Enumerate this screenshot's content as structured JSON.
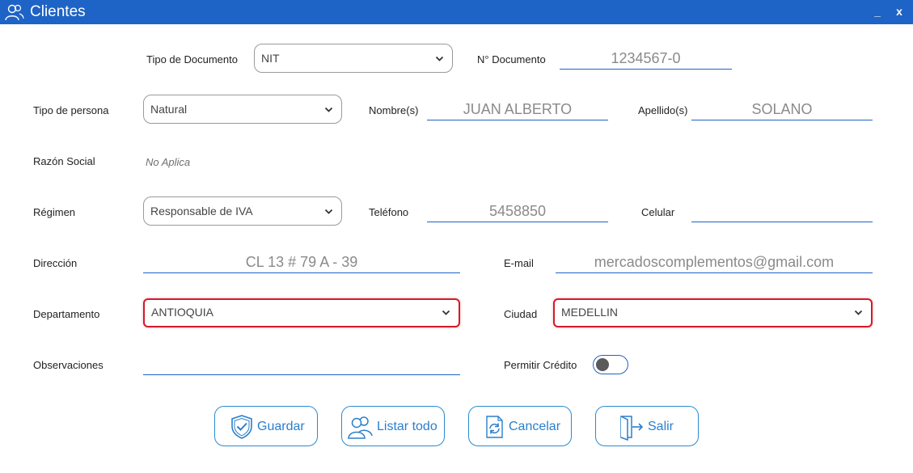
{
  "window": {
    "title": "Clientes",
    "minimize": "_",
    "close": "x",
    "accent": "#1e63c6"
  },
  "form": {
    "tipo_documento": {
      "label": "Tipo de Documento",
      "value": "NIT"
    },
    "numero_documento": {
      "label": "N° Documento",
      "value": "1234567-0"
    },
    "tipo_persona": {
      "label": "Tipo de persona",
      "value": "Natural"
    },
    "nombres": {
      "label": "Nombre(s)",
      "value": "JUAN ALBERTO"
    },
    "apellidos": {
      "label": "Apellido(s)",
      "value": "SOLANO"
    },
    "razon_social": {
      "label": "Razón Social",
      "value": "No Aplica"
    },
    "regimen": {
      "label": "Régimen",
      "value": "Responsable de IVA"
    },
    "telefono": {
      "label": "Teléfono",
      "value": "5458850"
    },
    "celular": {
      "label": "Celular",
      "value": ""
    },
    "direccion": {
      "label": "Dirección",
      "value": "CL 13 # 79 A - 39"
    },
    "email": {
      "label": "E-mail",
      "value": "mercadoscomplementos@gmail.com"
    },
    "departamento": {
      "label": "Departamento",
      "value": "ANTIOQUIA"
    },
    "ciudad": {
      "label": "Ciudad",
      "value": "MEDELLIN"
    },
    "observaciones": {
      "label": "Observaciones",
      "value": ""
    },
    "permitir_credito": {
      "label": "Permitir Crédito",
      "checked": false
    }
  },
  "buttons": {
    "guardar": "Guardar",
    "listar": "Listar todo",
    "cancelar": "Cancelar",
    "salir": "Salir"
  },
  "icons": {
    "title": "users-icon",
    "guardar": "shield-check-icon",
    "listar": "users-icon",
    "cancelar": "refresh-icon",
    "salir": "exit-door-icon",
    "dropdown": "chevron-down-icon"
  },
  "colors": {
    "error_border": "#d21b2b",
    "button_text": "#2a7fcc",
    "field_text": "#8a8a8a"
  }
}
